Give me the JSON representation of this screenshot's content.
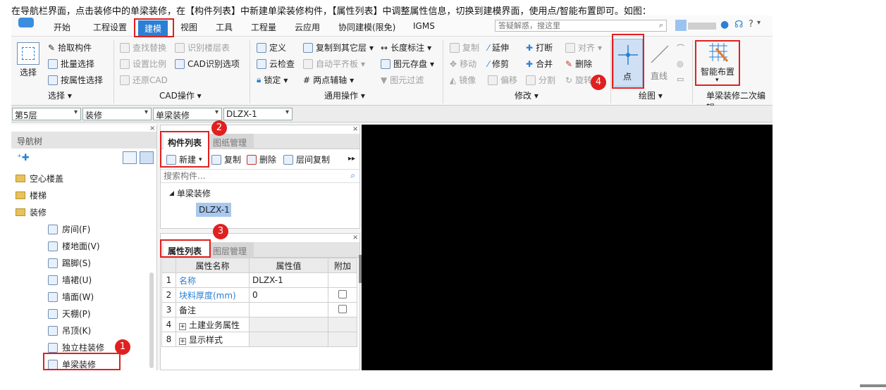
{
  "caption": "在导航栏界面，点击装修中的单梁装修，在【构件列表】中新建单梁装修构件，【属性列表】中调整属性信息，切换到建模界面，使用点/智能布置即可。如图：",
  "menu_tabs": [
    "开始",
    "工程设置",
    "建模",
    "视图",
    "工具",
    "工程量",
    "云应用",
    "协同建模(限免)",
    "IGMS"
  ],
  "search_placeholder": "答疑解惑，搜这里",
  "ribbon": {
    "select": {
      "select_label": "选择",
      "pick": "拾取构件",
      "batch": "批量选择",
      "by_attr": "按属性选择",
      "group": "选择"
    },
    "cad": {
      "find_replace": "查找替换",
      "identify_floor": "识别楼层表",
      "set_scale": "设置比例",
      "cad_options": "CAD识别选项",
      "restore": "还原CAD",
      "group": "CAD操作"
    },
    "general": {
      "define": "定义",
      "copy_to_floor": "复制到其它层",
      "length_mark": "长度标注",
      "cloud_check": "云检查",
      "auto_flat": "自动平齐板",
      "elem_save": "图元存盘",
      "lock": "锁定",
      "two_point_axis": "两点辅轴",
      "elem_filter": "图元过滤",
      "group": "通用操作"
    },
    "modify": {
      "copy": "复制",
      "extend": "延伸",
      "break": "打断",
      "align": "对齐",
      "move": "移动",
      "trim": "修剪",
      "merge": "合并",
      "delete": "删除",
      "mirror": "镜像",
      "offset": "偏移",
      "split": "分割",
      "rotate": "旋转",
      "group": "修改"
    },
    "draw": {
      "point": "点",
      "line": "直线",
      "group": "绘图"
    },
    "smart": {
      "label": "智能布置",
      "group": "单梁装修二次编辑"
    }
  },
  "selectors": [
    "第5层",
    "装修",
    "单梁装修",
    "DLZX-1"
  ],
  "nav": {
    "title": "导航树",
    "items": [
      "空心楼盖",
      "楼梯",
      "装修",
      "房间(F)",
      "楼地面(V)",
      "踢脚(S)",
      "墙裙(U)",
      "墙面(W)",
      "天棚(P)",
      "吊顶(K)",
      "独立柱装修",
      "单梁装修"
    ]
  },
  "component_panel": {
    "tab_active": "构件列表",
    "tab_other": "图纸管理",
    "new": "新建",
    "copy": "复制",
    "delete": "删除",
    "floor_copy": "层间复制",
    "search_placeholder": "搜索构件...",
    "tree_root": "单梁装修",
    "tree_child": "DLZX-1"
  },
  "property_panel": {
    "tab_active": "属性列表",
    "tab_other": "图层管理",
    "headers": [
      "属性名称",
      "属性值",
      "附加"
    ],
    "rows": [
      {
        "num": "1",
        "name": "名称",
        "value": "DLZX-1",
        "blue": true,
        "checkbox": false,
        "expand": false
      },
      {
        "num": "2",
        "name": "块料厚度(mm)",
        "value": "0",
        "blue": true,
        "checkbox": true,
        "expand": false
      },
      {
        "num": "3",
        "name": "备注",
        "value": "",
        "blue": false,
        "checkbox": true,
        "expand": false
      },
      {
        "num": "4",
        "name": "土建业务属性",
        "value": "",
        "blue": false,
        "checkbox": false,
        "expand": true
      },
      {
        "num": "8",
        "name": "显示样式",
        "value": "",
        "blue": false,
        "checkbox": false,
        "expand": true
      }
    ]
  },
  "badges": [
    "1",
    "2",
    "3",
    "4"
  ],
  "colors": {
    "accent": "#2b7fd4",
    "highlight": "#e02020",
    "canvas": "#000000",
    "selected": "#a9c8ef"
  }
}
